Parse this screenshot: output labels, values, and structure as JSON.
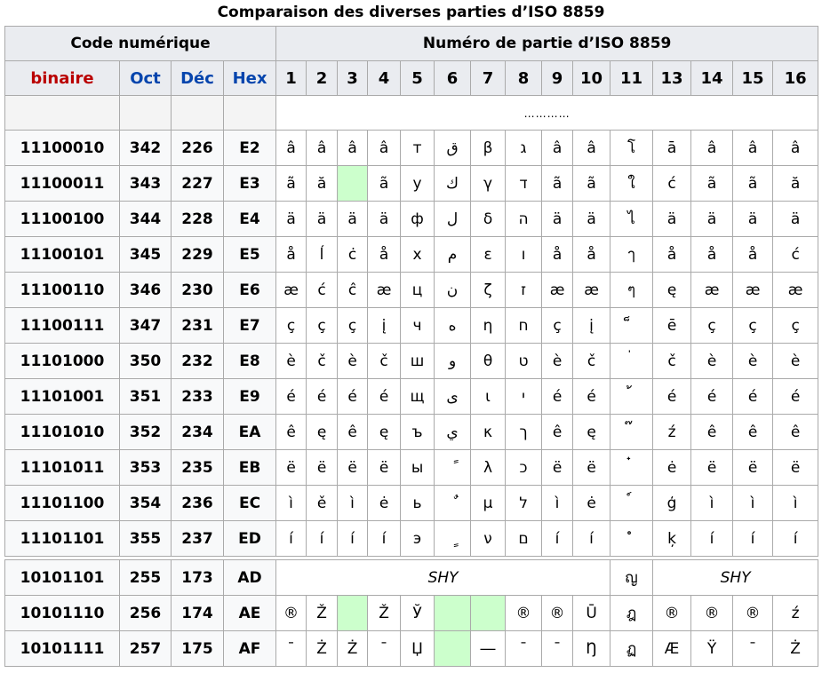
{
  "title": "Comparaison des diverses parties d’ISO 8859",
  "headers": {
    "code_numerique": "Code numérique",
    "numero_partie": "Numéro de partie d’ISO 8859",
    "binaire": "binaire",
    "oct": "Oct",
    "dec": "Déc",
    "hex": "Hex",
    "parts": [
      "1",
      "2",
      "3",
      "4",
      "5",
      "6",
      "7",
      "8",
      "9",
      "10",
      "11",
      "13",
      "14",
      "15",
      "16"
    ]
  },
  "placeholder_row": {
    "dots": "…………"
  },
  "rows": [
    {
      "bin": "11100010",
      "oct": "342",
      "dec": "226",
      "hex": "E2",
      "cells": [
        "â",
        "â",
        "â",
        "â",
        "т",
        "ق",
        "β",
        "ג",
        "â",
        "â",
        "โ",
        "ā",
        "â",
        "â",
        "â"
      ]
    },
    {
      "bin": "11100011",
      "oct": "343",
      "dec": "227",
      "hex": "E3",
      "cells": [
        "ã",
        "ă",
        "",
        "ã",
        "у",
        "ك",
        "γ",
        "ד",
        "ã",
        "ã",
        "ใ",
        "ć",
        "ã",
        "ã",
        "ă"
      ]
    },
    {
      "bin": "11100100",
      "oct": "344",
      "dec": "228",
      "hex": "E4",
      "cells": [
        "ä",
        "ä",
        "ä",
        "ä",
        "ф",
        "ل",
        "δ",
        "ה",
        "ä",
        "ä",
        "ไ",
        "ä",
        "ä",
        "ä",
        "ä"
      ]
    },
    {
      "bin": "11100101",
      "oct": "345",
      "dec": "229",
      "hex": "E5",
      "cells": [
        "å",
        "ĺ",
        "ċ",
        "å",
        "х",
        "م",
        "ε",
        "ו",
        "å",
        "å",
        "ๅ",
        "å",
        "å",
        "å",
        "ć"
      ]
    },
    {
      "bin": "11100110",
      "oct": "346",
      "dec": "230",
      "hex": "E6",
      "cells": [
        "æ",
        "ć",
        "ĉ",
        "æ",
        "ц",
        "ن",
        "ζ",
        "ז",
        "æ",
        "æ",
        "ๆ",
        "ę",
        "æ",
        "æ",
        "æ"
      ]
    },
    {
      "bin": "11100111",
      "oct": "347",
      "dec": "231",
      "hex": "E7",
      "cells": [
        "ç",
        "ç",
        "ç",
        "į",
        "ч",
        "ه",
        "η",
        "ח",
        "ç",
        "į",
        "็",
        "ē",
        "ç",
        "ç",
        "ç"
      ]
    },
    {
      "bin": "11101000",
      "oct": "350",
      "dec": "232",
      "hex": "E8",
      "cells": [
        "è",
        "č",
        "è",
        "č",
        "ш",
        "و",
        "θ",
        "ט",
        "è",
        "č",
        "่",
        "č",
        "è",
        "è",
        "è"
      ]
    },
    {
      "bin": "11101001",
      "oct": "351",
      "dec": "233",
      "hex": "E9",
      "cells": [
        "é",
        "é",
        "é",
        "é",
        "щ",
        "ى",
        "ι",
        "י",
        "é",
        "é",
        "้",
        "é",
        "é",
        "é",
        "é"
      ]
    },
    {
      "bin": "11101010",
      "oct": "352",
      "dec": "234",
      "hex": "EA",
      "cells": [
        "ê",
        "ę",
        "ê",
        "ę",
        "ъ",
        "ي",
        "κ",
        "ך",
        "ê",
        "ę",
        "๊",
        "ź",
        "ê",
        "ê",
        "ê"
      ]
    },
    {
      "bin": "11101011",
      "oct": "353",
      "dec": "235",
      "hex": "EB",
      "cells": [
        "ë",
        "ë",
        "ë",
        "ë",
        "ы",
        "ً",
        "λ",
        "כ",
        "ë",
        "ë",
        "๋",
        "ė",
        "ë",
        "ë",
        "ë"
      ]
    },
    {
      "bin": "11101100",
      "oct": "354",
      "dec": "236",
      "hex": "EC",
      "cells": [
        "ì",
        "ě",
        "ì",
        "ė",
        "ь",
        "ٌ",
        "μ",
        "ל",
        "ì",
        "ė",
        "์",
        "ģ",
        "ì",
        "ì",
        "ì"
      ]
    },
    {
      "bin": "11101101",
      "oct": "355",
      "dec": "237",
      "hex": "ED",
      "cells": [
        "í",
        "í",
        "í",
        "í",
        "э",
        "ٍ",
        "ν",
        "ם",
        "í",
        "í",
        "ํ",
        "ķ",
        "í",
        "í",
        "í"
      ]
    }
  ],
  "special_rows": [
    {
      "bin": "10101101",
      "oct": "255",
      "dec": "173",
      "hex": "AD",
      "shy1": "SHY",
      "thai": "ญ",
      "shy2": "SHY"
    },
    {
      "bin": "10101110",
      "oct": "256",
      "dec": "174",
      "hex": "AE",
      "cells": [
        "®",
        "Ž",
        "",
        "Ž",
        "Ў",
        "",
        "",
        "®",
        "®",
        "Ū",
        "ฎ",
        "®",
        "®",
        "®",
        "ź"
      ]
    },
    {
      "bin": "10101111",
      "oct": "257",
      "dec": "175",
      "hex": "AF",
      "cells": [
        "¯",
        "Ż",
        "Ż",
        "¯",
        "Џ",
        "",
        "―",
        "¯",
        "¯",
        "Ŋ",
        "ฏ",
        "Æ",
        "Ÿ",
        "¯",
        "Ż"
      ]
    }
  ],
  "colors": {
    "binaire": "#ba0000",
    "base_headers": "#0645ad",
    "empty_cell": "#ccffcc",
    "header_bg": "#eaecf0",
    "border": "#aaaaaa"
  }
}
